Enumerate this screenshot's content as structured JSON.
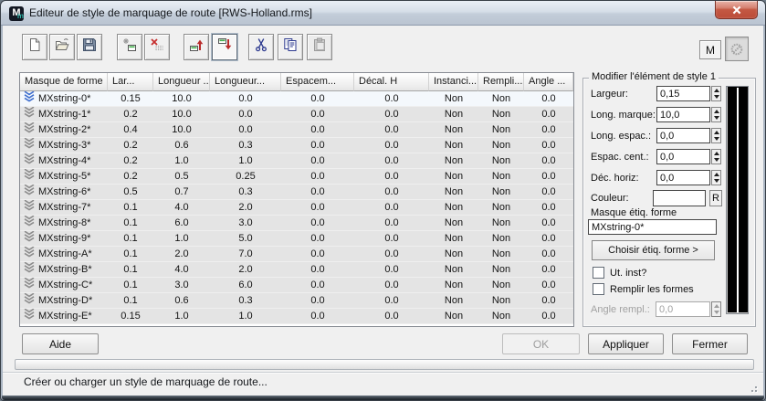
{
  "window": {
    "title": "Editeur de style de marquage de route [RWS-Holland.rms]",
    "icon": {
      "main": "M",
      "sub": "m"
    }
  },
  "toolbar": {
    "buttons": [
      {
        "name": "new-style-button",
        "icon": "new-document-icon",
        "enabled": true,
        "active": false
      },
      {
        "name": "open-style-button",
        "icon": "open-folder-icon",
        "enabled": true,
        "active": false
      },
      {
        "name": "save-style-button",
        "icon": "save-icon",
        "enabled": true,
        "active": false
      },
      {
        "name": "new-element-button",
        "icon": "new-element-icon",
        "enabled": true,
        "active": false
      },
      {
        "name": "delete-element-button",
        "icon": "delete-element-icon",
        "enabled": true,
        "active": false
      },
      {
        "name": "move-element-up-button",
        "icon": "move-up-icon",
        "enabled": true,
        "active": false
      },
      {
        "name": "move-element-down-button",
        "icon": "move-down-icon",
        "enabled": true,
        "active": true
      },
      {
        "name": "cut-button",
        "icon": "cut-icon",
        "enabled": true,
        "active": false
      },
      {
        "name": "copy-button",
        "icon": "copy-icon",
        "enabled": true,
        "active": false
      },
      {
        "name": "paste-button",
        "icon": "paste-icon",
        "enabled": false,
        "active": false
      }
    ],
    "m_button_label": "M"
  },
  "table": {
    "columns": [
      "Masque de forme",
      "Lar...",
      "Longueur ...",
      "Longueur...",
      "Espacem...",
      "Décal. H",
      "Instanci...",
      "Rempli...",
      "Angle ..."
    ],
    "rows": [
      {
        "masque": "MXstring-0*",
        "values": [
          "0.15",
          "10.0",
          "0.0",
          "0.0",
          "0.0",
          "Non",
          "Non",
          "0.0"
        ],
        "selected": true
      },
      {
        "masque": "MXstring-1*",
        "values": [
          "0.2",
          "10.0",
          "0.0",
          "0.0",
          "0.0",
          "Non",
          "Non",
          "0.0"
        ],
        "selected": false
      },
      {
        "masque": "MXstring-2*",
        "values": [
          "0.4",
          "10.0",
          "0.0",
          "0.0",
          "0.0",
          "Non",
          "Non",
          "0.0"
        ],
        "selected": false
      },
      {
        "masque": "MXstring-3*",
        "values": [
          "0.2",
          "0.6",
          "0.3",
          "0.0",
          "0.0",
          "Non",
          "Non",
          "0.0"
        ],
        "selected": false
      },
      {
        "masque": "MXstring-4*",
        "values": [
          "0.2",
          "1.0",
          "1.0",
          "0.0",
          "0.0",
          "Non",
          "Non",
          "0.0"
        ],
        "selected": false
      },
      {
        "masque": "MXstring-5*",
        "values": [
          "0.2",
          "0.5",
          "0.25",
          "0.0",
          "0.0",
          "Non",
          "Non",
          "0.0"
        ],
        "selected": false
      },
      {
        "masque": "MXstring-6*",
        "values": [
          "0.5",
          "0.7",
          "0.3",
          "0.0",
          "0.0",
          "Non",
          "Non",
          "0.0"
        ],
        "selected": false
      },
      {
        "masque": "MXstring-7*",
        "values": [
          "0.1",
          "4.0",
          "2.0",
          "0.0",
          "0.0",
          "Non",
          "Non",
          "0.0"
        ],
        "selected": false
      },
      {
        "masque": "MXstring-8*",
        "values": [
          "0.1",
          "6.0",
          "3.0",
          "0.0",
          "0.0",
          "Non",
          "Non",
          "0.0"
        ],
        "selected": false
      },
      {
        "masque": "MXstring-9*",
        "values": [
          "0.1",
          "1.0",
          "5.0",
          "0.0",
          "0.0",
          "Non",
          "Non",
          "0.0"
        ],
        "selected": false
      },
      {
        "masque": "MXstring-A*",
        "values": [
          "0.1",
          "2.0",
          "7.0",
          "0.0",
          "0.0",
          "Non",
          "Non",
          "0.0"
        ],
        "selected": false
      },
      {
        "masque": "MXstring-B*",
        "values": [
          "0.1",
          "4.0",
          "2.0",
          "0.0",
          "0.0",
          "Non",
          "Non",
          "0.0"
        ],
        "selected": false
      },
      {
        "masque": "MXstring-C*",
        "values": [
          "0.1",
          "3.0",
          "6.0",
          "0.0",
          "0.0",
          "Non",
          "Non",
          "0.0"
        ],
        "selected": false
      },
      {
        "masque": "MXstring-D*",
        "values": [
          "0.1",
          "0.6",
          "0.3",
          "0.0",
          "0.0",
          "Non",
          "Non",
          "0.0"
        ],
        "selected": false
      },
      {
        "masque": "MXstring-E*",
        "values": [
          "0.15",
          "1.0",
          "1.0",
          "0.0",
          "0.0",
          "Non",
          "Non",
          "0.0"
        ],
        "selected": false
      }
    ]
  },
  "panel": {
    "title": "Modifier l'élément de style 1",
    "fields": [
      {
        "name": "largeur-field",
        "label": "Largeur:",
        "value": "0,15"
      },
      {
        "name": "long-marque-field",
        "label": "Long. marque:",
        "value": "10,0"
      },
      {
        "name": "long-espac-field",
        "label": "Long. espac.:",
        "value": "0,0"
      },
      {
        "name": "espac-cent-field",
        "label": "Espac. cent.:",
        "value": "0,0"
      },
      {
        "name": "dec-horiz-field",
        "label": "Déc. horiz:",
        "value": "0,0"
      }
    ],
    "couleur_label": "Couleur:",
    "r_button_label": "R",
    "masque_label": "Masque étiq. forme",
    "masque_value": "MXstring-0*",
    "choisir_button": "Choisir étiq. forme >",
    "checkbox_ut": "Ut. inst?",
    "checkbox_remplir": "Remplir les formes",
    "angle_label": "Angle rempl.:",
    "angle_value": "0,0"
  },
  "footer": {
    "aide": "Aide",
    "ok": "OK",
    "appliquer": "Appliquer",
    "fermer": "Fermer"
  },
  "statusbar": {
    "message": "Créer ou charger un style de marquage de route..."
  },
  "colors": {
    "selected_row": "#f4f8fc",
    "row_gray": "#e4e4e4",
    "selected_icon_blue": "#3f6fce",
    "close_button_red": "#c45843",
    "preview_background": "#000000",
    "preview_line": "#ffffff"
  }
}
